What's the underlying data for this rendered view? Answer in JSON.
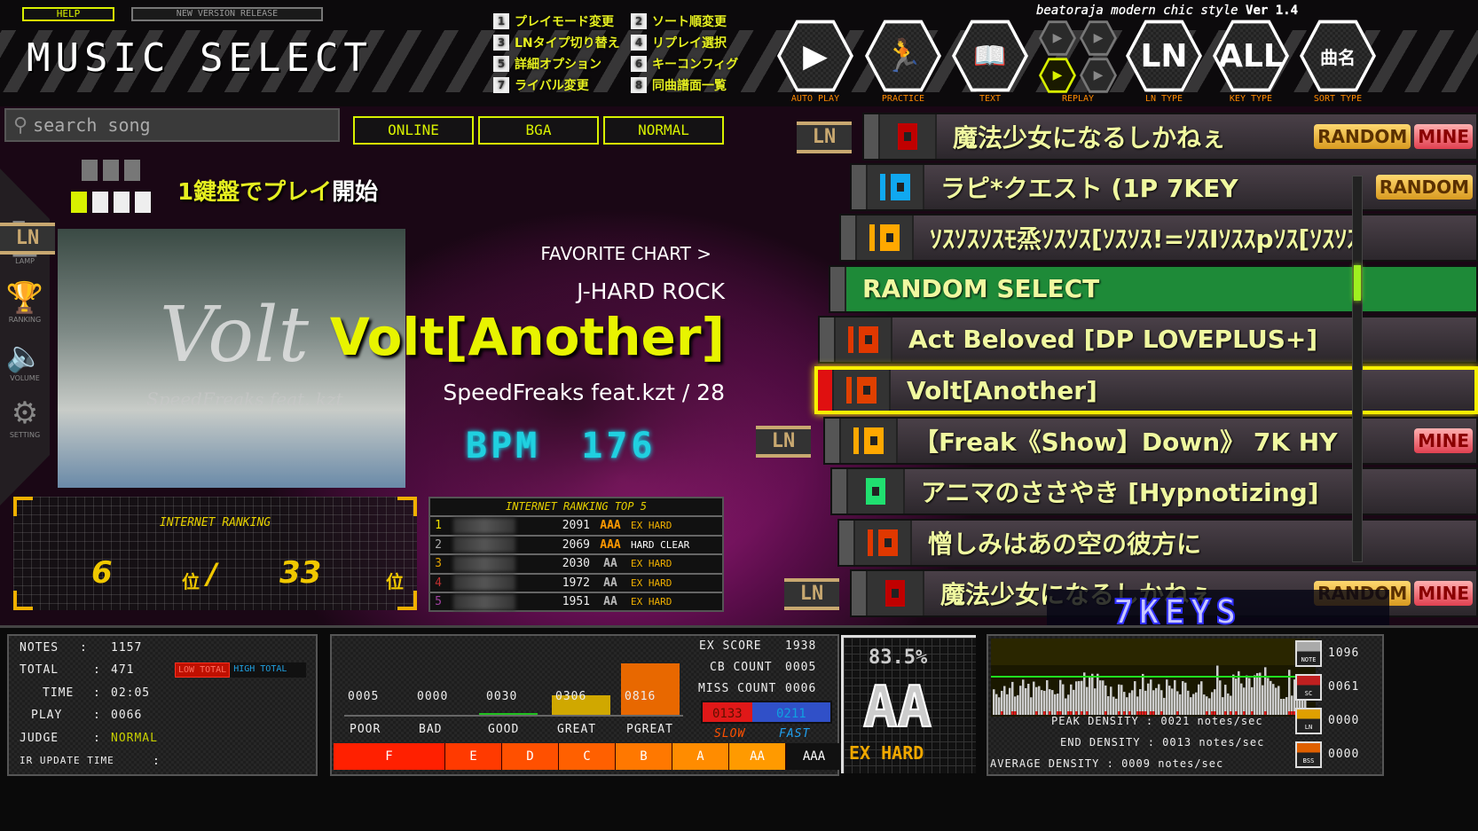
{
  "header": {
    "help": "HELP",
    "new_version": "NEW VERSION RELEASE",
    "title": "MUSIC SELECT",
    "brand": "beatoraja modern chic style",
    "version": "Ver 1.4"
  },
  "key_hints": [
    {
      "key": "1",
      "label": "プレイモード変更"
    },
    {
      "key": "2",
      "label": "ソート順変更"
    },
    {
      "key": "3",
      "label": "LNタイプ切り替え"
    },
    {
      "key": "4",
      "label": "リプレイ選択"
    },
    {
      "key": "5",
      "label": "詳細オプション"
    },
    {
      "key": "6",
      "label": "キーコンフィグ"
    },
    {
      "key": "7",
      "label": "ライバル変更"
    },
    {
      "key": "8",
      "label": "同曲譜面一覧"
    }
  ],
  "buttons": {
    "auto_play": "AUTO PLAY",
    "practice": "PRACTICE",
    "text": "TEXT",
    "replay": "REPLAY",
    "ln_type": "LN TYPE",
    "ln_value": "LN",
    "key_type": "KEY TYPE",
    "key_value": "ALL",
    "sort_type": "SORT TYPE",
    "sort_value": "曲名",
    "replay_slots": [
      "1",
      "2",
      "3",
      "4"
    ],
    "replay_selected": "3"
  },
  "search": {
    "placeholder": "search song"
  },
  "tabs": [
    "ONLINE",
    "BGA",
    "NORMAL"
  ],
  "side_menu": [
    "LAMP",
    "RANKING",
    "VOLUME",
    "SETTING"
  ],
  "start_hint": {
    "prefix": "1鍵盤で",
    "highlight": "プレイ",
    "suffix": "開始"
  },
  "song": {
    "favorite": "FAVORITE CHART >",
    "genre": "J-HARD ROCK",
    "title": "Volt[Another]",
    "artist": "SpeedFreaks feat.kzt / 28",
    "bpm_label": "BPM",
    "bpm": "176",
    "art_text": "Volt",
    "art_sub": "SpeedFreaks feat. kzt"
  },
  "internet_ranking": {
    "title": "INTERNET RANKING",
    "rank": "6",
    "total": "33",
    "unit": "位",
    "sep": "/"
  },
  "top5": {
    "title": "INTERNET RANKING TOP 5",
    "rows": [
      {
        "rank": "1",
        "score": "2091",
        "grade": "AAA",
        "clear": "EX HARD"
      },
      {
        "rank": "2",
        "score": "2069",
        "grade": "AAA",
        "clear": "HARD CLEAR"
      },
      {
        "rank": "3",
        "score": "2030",
        "grade": "AA",
        "clear": "EX HARD"
      },
      {
        "rank": "4",
        "score": "1972",
        "grade": "AA",
        "clear": "EX HARD"
      },
      {
        "rank": "5",
        "score": "1951",
        "grade": "AA",
        "clear": "EX HARD"
      }
    ]
  },
  "song_list": [
    {
      "title": "魔法少女になるしかねぇ",
      "badges": [
        "RANDOM",
        "MINE"
      ],
      "ln": true,
      "lamp": "#c00000",
      "bar": false
    },
    {
      "title": "ラピ*クエスト (1P 7KEY",
      "badges": [
        "RANDOM"
      ],
      "ln": false,
      "lamp": "#10a8f0",
      "bar": true
    },
    {
      "title": "ｿｽｿｽｿｽﾓ烝ｿｽｿｽ[ｿｽｿｽ!=ｿｽIｿｽｽpｿｽ[ｿｽｿｽ",
      "badges": [],
      "ln": true,
      "lamp": "#ffa800",
      "bar": true
    },
    {
      "title": "RANDOM SELECT",
      "badges": [],
      "ln": false,
      "lamp": "",
      "bar": false
    },
    {
      "title": "Act Beloved [DP LOVEPLUS+]",
      "badges": [],
      "ln": false,
      "lamp": "#e03800",
      "bar": true
    },
    {
      "title": "Volt[Another]",
      "badges": [],
      "ln": false,
      "lamp": "#e04000",
      "bar": true
    },
    {
      "title": "【Freak《Show】Down》 7K HY",
      "badges": [
        "MINE"
      ],
      "ln": true,
      "lamp": "#ffa800",
      "bar": true
    },
    {
      "title": "アニマのささやき [Hypnotizing]",
      "badges": [],
      "ln": false,
      "lamp": "#20e070",
      "bar": false
    },
    {
      "title": "憎しみはあの空の彼方に",
      "badges": [],
      "ln": false,
      "lamp": "#e03800",
      "bar": true
    },
    {
      "title": "魔法少女になるしかねぇ",
      "badges": [
        "RANDOM",
        "MINE"
      ],
      "ln": true,
      "lamp": "#c00000",
      "bar": false
    }
  ],
  "scroll_position": 0.25,
  "key_mode": "7KEYS",
  "stats": {
    "notes_label": "NOTES",
    "notes": "1157",
    "total_label": "TOTAL",
    "total": "471",
    "low_total": "LOW TOTAL",
    "high_total": "HIGH TOTAL",
    "time_label": "TIME",
    "time": "02:05",
    "play_label": "PLAY",
    "play": "0066",
    "judge_label": "JUDGE",
    "judge": "NORMAL",
    "ir_label": "IR UPDATE TIME",
    "ir": ""
  },
  "judges": [
    {
      "label": "POOR",
      "value": "0005"
    },
    {
      "label": "BAD",
      "value": "0000"
    },
    {
      "label": "GOOD",
      "value": "0030"
    },
    {
      "label": "GREAT",
      "value": "0306"
    },
    {
      "label": "PGREAT",
      "value": "0816"
    }
  ],
  "score": {
    "ex_label": "EX SCORE",
    "ex": "1938",
    "cb_label": "CB COUNT",
    "cb": "0005",
    "miss_label": "MISS COUNT",
    "miss": "0006",
    "slow": "0133",
    "fast": "0211",
    "slow_label": "SLOW",
    "fast_label": "FAST",
    "rate": "83.5%",
    "grade": "AA",
    "clear": "EX HARD"
  },
  "grades": [
    "F",
    "E",
    "D",
    "C",
    "B",
    "A",
    "AA",
    "AAA"
  ],
  "grade_colors": [
    "#ff2000",
    "#ff3a00",
    "#ff5000",
    "#ff6000",
    "#ff7800",
    "#ff8c00",
    "#ff9a00",
    "#111111"
  ],
  "density": {
    "peak_label": "PEAK DENSITY",
    "peak": "0021",
    "end_label": "END DENSITY",
    "end": "0013",
    "avg_label": "AVERAGE DENSITY",
    "avg": "0009",
    "unit": "notes/sec",
    "counts": [
      {
        "label": "NOTE",
        "value": "1096"
      },
      {
        "label": "SC",
        "value": "0061"
      },
      {
        "label": "LN",
        "value": "0000"
      },
      {
        "label": "BSS",
        "value": "0000"
      }
    ]
  }
}
